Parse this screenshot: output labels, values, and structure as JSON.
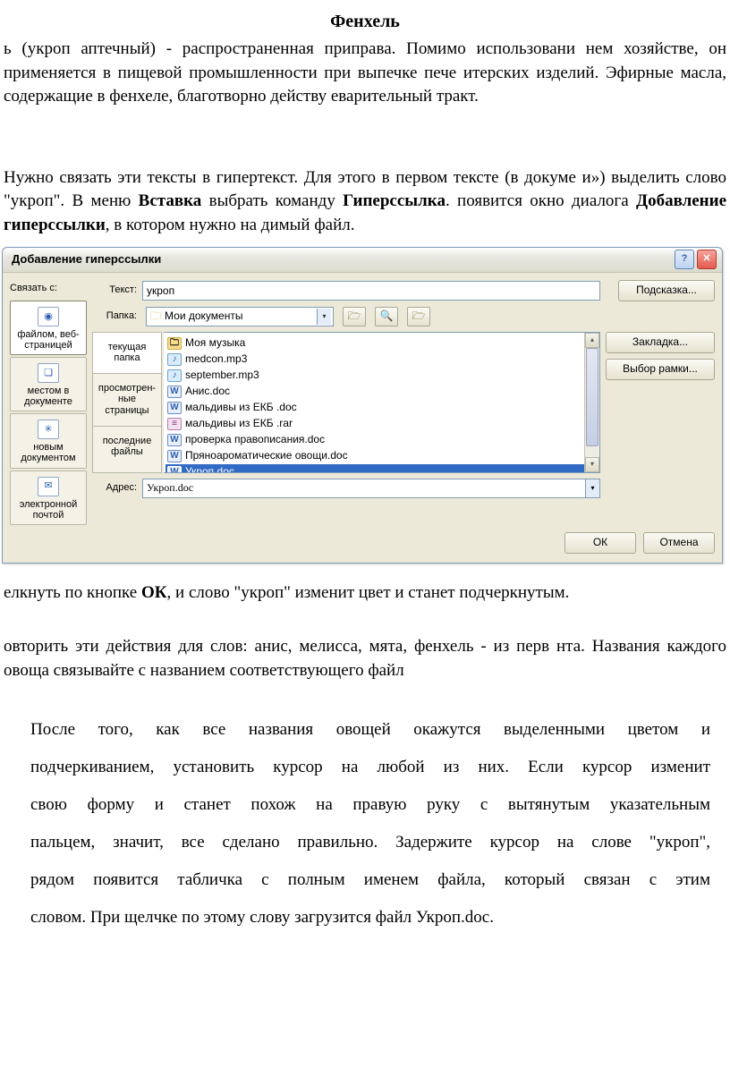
{
  "title": "Фенхель",
  "p1": "ь (укроп аптечный) - распространенная приправа. Помимо использовани нем хозяйстве, он применяется в пищевой промышленности при выпечке пече итерских изделий. Эфирные масла, содержащие в фенхеле, благотворно действу еварительный тракт.",
  "p2_prefix": "Нужно связать эти тексты в гипертекст. Для этого в первом тексте (в докуме и») выделить слово \"укроп\". В меню ",
  "p2_b1": "Вставка",
  "p2_mid1": " выбрать команду ",
  "p2_b2": "Гиперссылка",
  "p2_after": ". появится окно диалога ",
  "p2_b3": "Добавление гиперссылки",
  "p2_tail": ", в котором нужно на димый файл.",
  "p_ok_before": "елкнуть по кнопке ",
  "p_ok_b": "ОК",
  "p_ok_after": ", и слово \"укроп\" изменит цвет и станет подчеркнутым.",
  "p_repeat": "овторить эти действия для слов: анис, мелисса, мята, фенхель - из перв нта. Названия каждого овоща связывайте с названием соответствующего файл",
  "p_after1": "После того,  как все названия овощей окажутся выделенными цветом и",
  "p_after2": "подчеркиванием, установить курсор на любой из них. Если курсор изменит",
  "p_after3": "свою форму и станет похож на правую руку с вытянутым указательным",
  "p_after4": "пальцем, значит, все сделано правильно. Задержите курсор на слове \"укроп\",",
  "p_after5": "рядом появится табличка с полным именем файла, который связан с этим",
  "p_after6": "словом. При щелчке по этому слову загрузится файл Укроп.doc.",
  "dialog": {
    "title": "Добавление гиперссылки",
    "link_with": "Связать с:",
    "tabs": {
      "file": "файлом, веб-страницей",
      "place": "местом в документе",
      "newdoc": "новым документом",
      "email": "электронной почтой"
    },
    "text_label": "Текст:",
    "text_value": "укроп",
    "hint_btn": "Подсказка...",
    "folder_label": "Папка:",
    "folder_value": "Мои документы",
    "browseTabs": {
      "current": "текущая папка",
      "viewed": "просмотрен-ные страницы",
      "recent": "последние файлы"
    },
    "files": [
      {
        "name": "Моя музыка",
        "type": "folder"
      },
      {
        "name": "medcon.mp3",
        "type": "mp3"
      },
      {
        "name": "september.mp3",
        "type": "mp3"
      },
      {
        "name": "Анис.doc",
        "type": "doc"
      },
      {
        "name": "мальдивы из ЕКБ .doc",
        "type": "doc"
      },
      {
        "name": "мальдивы из ЕКБ .rar",
        "type": "rar"
      },
      {
        "name": "проверка правописания.doc",
        "type": "doc"
      },
      {
        "name": "Пряноароматические овощи.doc",
        "type": "doc"
      },
      {
        "name": "Укроп.doc",
        "type": "doc",
        "selected": true
      }
    ],
    "bookmark_btn": "Закладка...",
    "frame_btn": "Выбор рамки...",
    "addr_label": "Адрес:",
    "addr_value": "Укроп.doc",
    "ok": "ОК",
    "cancel": "Отмена"
  },
  "glyph": {
    "help": "?",
    "close": "✕",
    "down": "▾",
    "up_small": "▴",
    "down_small": "▾",
    "doc": "W",
    "folder_open": "📂"
  }
}
